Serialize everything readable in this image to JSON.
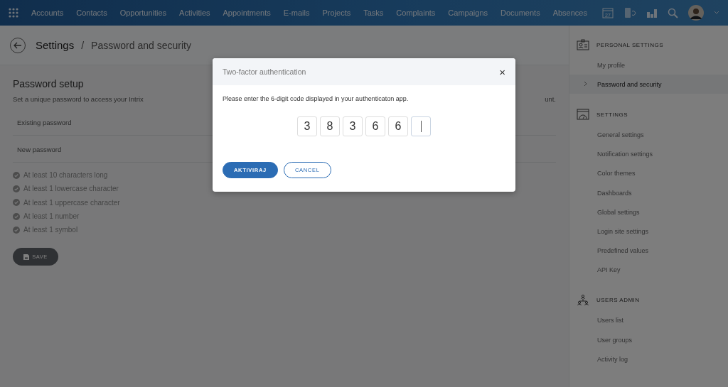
{
  "nav": {
    "items": [
      "Accounts",
      "Contacts",
      "Opportunities",
      "Activities",
      "Appointments",
      "E-mails",
      "Projects",
      "Tasks",
      "Complaints",
      "Campaigns",
      "Documents",
      "Absences"
    ],
    "calendar_day": "27"
  },
  "header": {
    "title": "Settings",
    "separator": "/",
    "subtitle": "Password and security"
  },
  "password_setup": {
    "title": "Password setup",
    "description": "Set a unique password to access your Intrix",
    "description_tail": "unt.",
    "fields": [
      {
        "label": "Existing password"
      },
      {
        "label": "New password"
      }
    ],
    "requirements": [
      "At least 10 characters long",
      "At least 1 lowercase character",
      "At least 1 uppercase character",
      "At least 1 number",
      "At least 1 symbol"
    ],
    "save_button": "SAVE"
  },
  "sidebar": {
    "sections": [
      {
        "title": "PERSONAL SETTINGS",
        "kind": "profile",
        "items": [
          {
            "label": "My profile",
            "selected": false
          },
          {
            "label": "Password and security",
            "selected": true
          }
        ]
      },
      {
        "title": "SETTINGS",
        "kind": "settings",
        "items": [
          {
            "label": "General settings",
            "selected": false
          },
          {
            "label": "Notification settings",
            "selected": false
          },
          {
            "label": "Color themes",
            "selected": false
          },
          {
            "label": "Dashboards",
            "selected": false
          },
          {
            "label": "Global settings",
            "selected": false
          },
          {
            "label": "Login site settings",
            "selected": false
          },
          {
            "label": "Predefined values",
            "selected": false
          },
          {
            "label": "API Key",
            "selected": false
          }
        ]
      },
      {
        "title": "USERS ADMIN",
        "kind": "users",
        "items": [
          {
            "label": "Users list",
            "selected": false
          },
          {
            "label": "User groups",
            "selected": false
          },
          {
            "label": "Activity log",
            "selected": false
          }
        ]
      }
    ]
  },
  "dialog": {
    "title": "Two-factor authentication",
    "close": "×",
    "message": "Please enter the 6-digit code displayed in your authenticaton app.",
    "code": [
      {
        "value": "3",
        "focused": false
      },
      {
        "value": "8",
        "focused": false
      },
      {
        "value": "3",
        "focused": false
      },
      {
        "value": "6",
        "focused": false
      },
      {
        "value": "6",
        "focused": false
      },
      {
        "focused": true
      }
    ],
    "buttons": [
      {
        "label": "AKTIVIRAJ",
        "kind": "primary"
      },
      {
        "label": "CANCEL",
        "kind": "secondary"
      }
    ]
  }
}
